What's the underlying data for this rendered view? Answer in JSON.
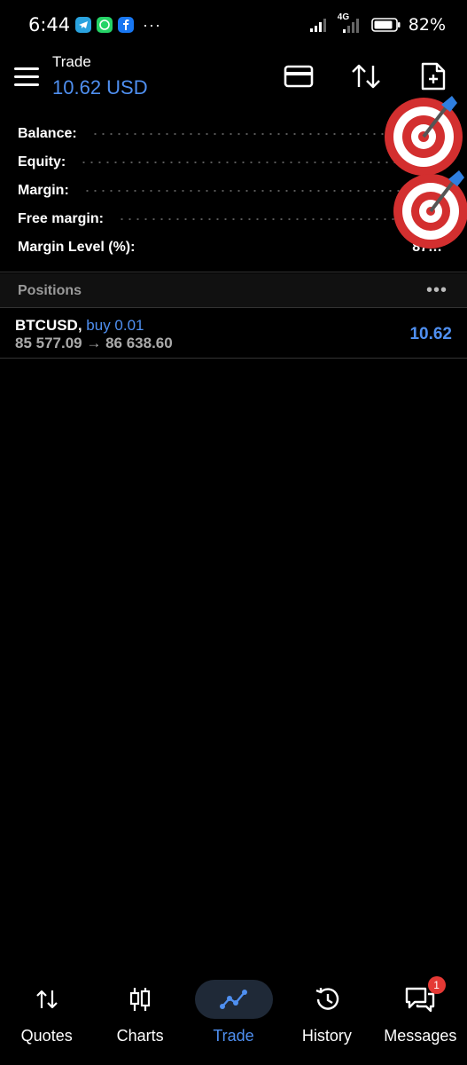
{
  "status_bar": {
    "time": "6:44",
    "more": "···",
    "network": "4G",
    "battery": "82%"
  },
  "header": {
    "title": "Trade",
    "subtitle": "10.62 USD"
  },
  "summary": [
    {
      "label": "Balance:",
      "value": ""
    },
    {
      "label": "Equity:",
      "value": ""
    },
    {
      "label": "Margin:",
      "value": ""
    },
    {
      "label": "Free margin:",
      "value": ""
    },
    {
      "label": "Margin Level (%):",
      "value": "87…"
    }
  ],
  "positions": {
    "title": "Positions",
    "more": "•••",
    "items": [
      {
        "symbol": "BTCUSD,",
        "side": "buy 0.01",
        "prices": "85 577.09 → 86 638.60",
        "profit": "10.62"
      }
    ]
  },
  "nav": {
    "items": [
      {
        "label": "Quotes"
      },
      {
        "label": "Charts"
      },
      {
        "label": "Trade"
      },
      {
        "label": "History"
      },
      {
        "label": "Messages",
        "badge": "1"
      }
    ]
  },
  "colors": {
    "accent": "#4f8ff0",
    "background": "#000000",
    "badge": "#e53935"
  }
}
